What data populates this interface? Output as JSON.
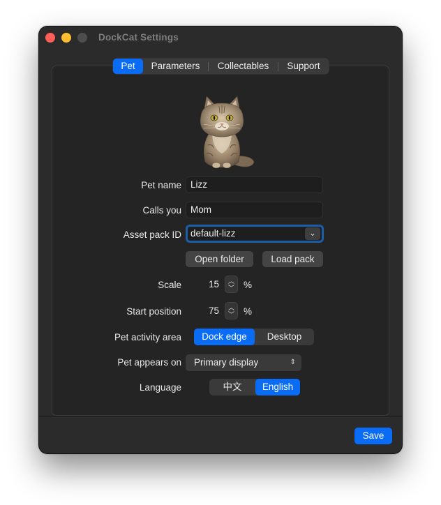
{
  "window": {
    "title": "DockCat Settings"
  },
  "tabs": [
    {
      "label": "Pet",
      "active": true
    },
    {
      "label": "Parameters",
      "active": false
    },
    {
      "label": "Collectables",
      "active": false
    },
    {
      "label": "Support",
      "active": false
    }
  ],
  "pet": {
    "image_icon": "cat-portrait"
  },
  "form": {
    "pet_name": {
      "label": "Pet name",
      "value": "Lizz"
    },
    "calls_you": {
      "label": "Calls you",
      "value": "Mom"
    },
    "asset_pack": {
      "label": "Asset pack ID",
      "value": "default-lizz"
    },
    "open_folder": "Open folder",
    "load_pack": "Load pack",
    "scale": {
      "label": "Scale",
      "value": "15",
      "unit": "%"
    },
    "start_position": {
      "label": "Start position",
      "value": "75",
      "unit": "%"
    },
    "activity_area": {
      "label": "Pet activity area",
      "options": [
        "Dock edge",
        "Desktop"
      ],
      "selected": "Dock edge"
    },
    "appears_on": {
      "label": "Pet appears on",
      "value": "Primary display"
    },
    "language": {
      "label": "Language",
      "options": [
        "中文",
        "English"
      ],
      "selected": "English"
    }
  },
  "footer": {
    "save": "Save"
  },
  "colors": {
    "accent": "#0a6cf5",
    "window_bg": "#2b2b2b",
    "panel_bg": "#242424",
    "focus_ring": "#1b5fa8"
  }
}
